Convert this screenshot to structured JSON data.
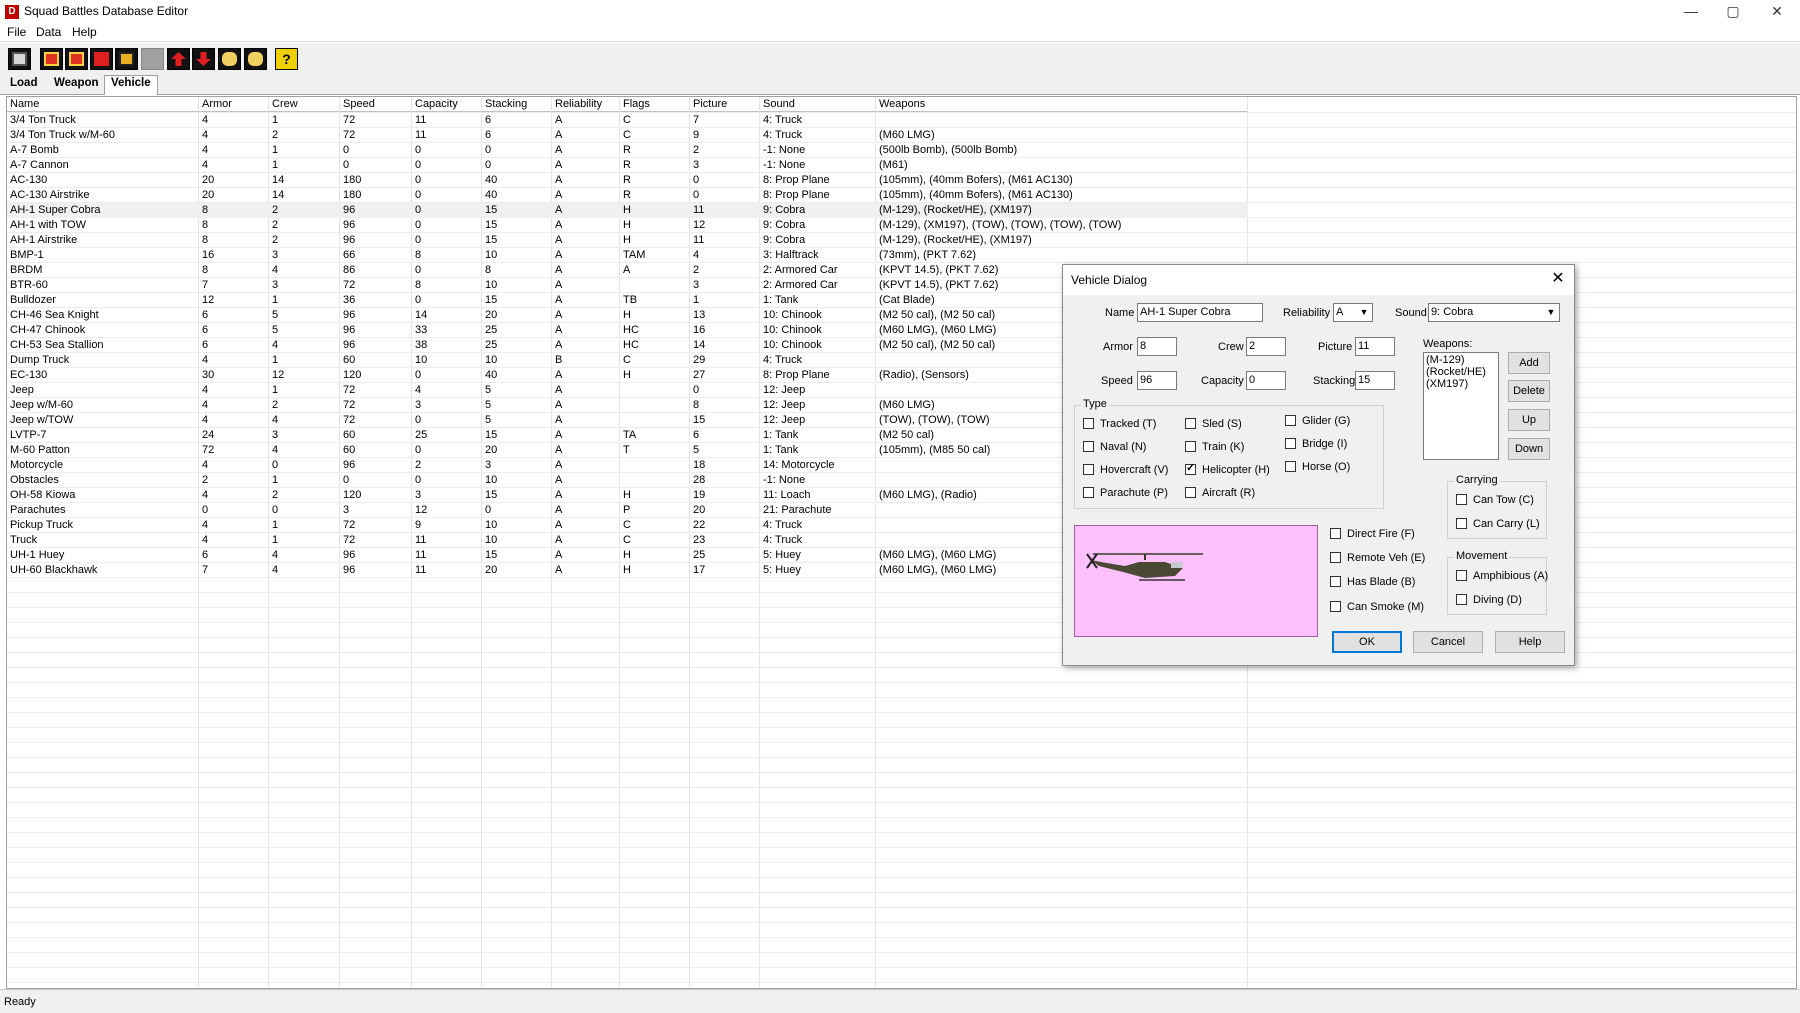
{
  "window": {
    "title": "Squad Battles Database Editor",
    "app_icon": "D",
    "buttons": {
      "minimize": "—",
      "maximize": "▢",
      "close": "✕"
    }
  },
  "menu": [
    "File",
    "Data",
    "Help"
  ],
  "toolbar": {
    "icons": [
      "save-icon",
      "new-record-icon",
      "new-record-2-icon",
      "delete-icon",
      "copy-icon",
      "disabled-icon",
      "move-up-icon",
      "move-down-icon",
      "binoculars-icon",
      "binoculars-2-icon",
      "help-icon"
    ],
    "help_glyph": "?"
  },
  "tabs": [
    "Load",
    "Weapon",
    "Vehicle"
  ],
  "grid": {
    "columns": [
      "Name",
      "Armor",
      "Crew",
      "Speed",
      "Capacity",
      "Stacking",
      "Reliability",
      "Flags",
      "Picture",
      "Sound",
      "Weapons"
    ],
    "rows": [
      [
        "3/4 Ton Truck",
        "4",
        "1",
        "72",
        "11",
        "6",
        "A",
        "C",
        "7",
        "4: Truck",
        ""
      ],
      [
        "3/4 Ton Truck w/M-60",
        "4",
        "2",
        "72",
        "11",
        "6",
        "A",
        "C",
        "9",
        "4: Truck",
        "(M60 LMG)"
      ],
      [
        "A-7 Bomb",
        "4",
        "1",
        "0",
        "0",
        "0",
        "A",
        "R",
        "2",
        "-1: None",
        "(500lb Bomb), (500lb Bomb)"
      ],
      [
        "A-7 Cannon",
        "4",
        "1",
        "0",
        "0",
        "0",
        "A",
        "R",
        "3",
        "-1: None",
        "(M61)"
      ],
      [
        "AC-130",
        "20",
        "14",
        "180",
        "0",
        "40",
        "A",
        "R",
        "0",
        "8: Prop Plane",
        "(105mm), (40mm Bofers), (M61 AC130)"
      ],
      [
        "AC-130 Airstrike",
        "20",
        "14",
        "180",
        "0",
        "40",
        "A",
        "R",
        "0",
        "8: Prop Plane",
        "(105mm), (40mm Bofers), (M61 AC130)"
      ],
      [
        "AH-1  Super Cobra",
        "8",
        "2",
        "96",
        "0",
        "15",
        "A",
        "H",
        "11",
        "9: Cobra",
        "(M-129), (Rocket/HE), (XM197)"
      ],
      [
        "AH-1 with TOW",
        "8",
        "2",
        "96",
        "0",
        "15",
        "A",
        "H",
        "12",
        "9: Cobra",
        "(M-129), (XM197), (TOW), (TOW), (TOW), (TOW)"
      ],
      [
        "AH-1 Airstrike",
        "8",
        "2",
        "96",
        "0",
        "15",
        "A",
        "H",
        "11",
        "9: Cobra",
        "(M-129), (Rocket/HE), (XM197)"
      ],
      [
        "BMP-1",
        "16",
        "3",
        "66",
        "8",
        "10",
        "A",
        "TAM",
        "4",
        "3: Halftrack",
        "(73mm), (PKT 7.62)"
      ],
      [
        "BRDM",
        "8",
        "4",
        "86",
        "0",
        "8",
        "A",
        "A",
        "2",
        "2: Armored Car",
        "(KPVT 14.5), (PKT 7.62)"
      ],
      [
        "BTR-60",
        "7",
        "3",
        "72",
        "8",
        "10",
        "A",
        "",
        "3",
        "2: Armored Car",
        "(KPVT 14.5), (PKT 7.62)"
      ],
      [
        "Bulldozer",
        "12",
        "1",
        "36",
        "0",
        "15",
        "A",
        "TB",
        "1",
        "1: Tank",
        "(Cat Blade)"
      ],
      [
        "CH-46 Sea Knight",
        "6",
        "5",
        "96",
        "14",
        "20",
        "A",
        "H",
        "13",
        "10: Chinook",
        "(M2 50 cal), (M2 50 cal)"
      ],
      [
        "CH-47 Chinook",
        "6",
        "5",
        "96",
        "33",
        "25",
        "A",
        "HC",
        "16",
        "10: Chinook",
        "(M60 LMG), (M60 LMG)"
      ],
      [
        "CH-53 Sea Stallion",
        "6",
        "4",
        "96",
        "38",
        "25",
        "A",
        "HC",
        "14",
        "10: Chinook",
        "(M2 50 cal), (M2 50 cal)"
      ],
      [
        "Dump Truck",
        "4",
        "1",
        "60",
        "10",
        "10",
        "B",
        "C",
        "29",
        "4: Truck",
        ""
      ],
      [
        "EC-130",
        "30",
        "12",
        "120",
        "0",
        "40",
        "A",
        "H",
        "27",
        "8: Prop Plane",
        "(Radio), (Sensors)"
      ],
      [
        "Jeep",
        "4",
        "1",
        "72",
        "4",
        "5",
        "A",
        "",
        "0",
        "12: Jeep",
        ""
      ],
      [
        "Jeep w/M-60",
        "4",
        "2",
        "72",
        "3",
        "5",
        "A",
        "",
        "8",
        "12: Jeep",
        "(M60 LMG)"
      ],
      [
        "Jeep w/TOW",
        "4",
        "4",
        "72",
        "0",
        "5",
        "A",
        "",
        "15",
        "12: Jeep",
        "(TOW), (TOW), (TOW)"
      ],
      [
        "LVTP-7",
        "24",
        "3",
        "60",
        "25",
        "15",
        "A",
        "TA",
        "6",
        "1: Tank",
        "(M2 50 cal)"
      ],
      [
        "M-60 Patton",
        "72",
        "4",
        "60",
        "0",
        "20",
        "A",
        "T",
        "5",
        "1: Tank",
        "(105mm), (M85 50 cal)"
      ],
      [
        "Motorcycle",
        "4",
        "0",
        "96",
        "2",
        "3",
        "A",
        "",
        "18",
        "14: Motorcycle",
        ""
      ],
      [
        "Obstacles",
        "2",
        "1",
        "0",
        "0",
        "10",
        "A",
        "",
        "28",
        "-1: None",
        ""
      ],
      [
        "OH-58 Kiowa",
        "4",
        "2",
        "120",
        "3",
        "15",
        "A",
        "H",
        "19",
        "11: Loach",
        "(M60 LMG), (Radio)"
      ],
      [
        "Parachutes",
        "0",
        "0",
        "3",
        "12",
        "0",
        "A",
        "P",
        "20",
        "21: Parachute",
        ""
      ],
      [
        "Pickup Truck",
        "4",
        "1",
        "72",
        "9",
        "10",
        "A",
        "C",
        "22",
        "4: Truck",
        ""
      ],
      [
        "Truck",
        "4",
        "1",
        "72",
        "11",
        "10",
        "A",
        "C",
        "23",
        "4: Truck",
        ""
      ],
      [
        "UH-1 Huey",
        "6",
        "4",
        "96",
        "11",
        "15",
        "A",
        "H",
        "25",
        "5: Huey",
        "(M60 LMG), (M60 LMG)"
      ],
      [
        "UH-60 Blackhawk",
        "7",
        "4",
        "96",
        "11",
        "20",
        "A",
        "H",
        "17",
        "5: Huey",
        "(M60 LMG), (M60 LMG)"
      ]
    ],
    "selected_row": 6
  },
  "status": "Ready",
  "dialog": {
    "title": "Vehicle Dialog",
    "close_glyph": "✕",
    "name_label": "Name",
    "name_value": "AH-1  Super Cobra",
    "reliability_label": "Reliability",
    "reliability_value": "A",
    "sound_label": "Sound",
    "sound_value": "9: Cobra",
    "armor_label": "Armor",
    "armor_value": "8",
    "crew_label": "Crew",
    "crew_value": "2",
    "picture_label": "Picture",
    "picture_value": "11",
    "speed_label": "Speed",
    "speed_value": "96",
    "capacity_label": "Capacity",
    "capacity_value": "0",
    "stacking_label": "Stacking",
    "stacking_value": "15",
    "weapons_label": "Weapons:",
    "weapons_list": [
      "(M-129)",
      "(Rocket/HE)",
      "(XM197)"
    ],
    "weapon_buttons": [
      "Add",
      "Delete",
      "Up",
      "Down"
    ],
    "type_label": "Type",
    "type_checks": [
      {
        "label": "Tracked (T)",
        "checked": false
      },
      {
        "label": "Naval (N)",
        "checked": false
      },
      {
        "label": "Hovercraft (V)",
        "checked": false
      },
      {
        "label": "Parachute (P)",
        "checked": false
      },
      {
        "label": "Sled (S)",
        "checked": false
      },
      {
        "label": "Train (K)",
        "checked": false
      },
      {
        "label": "Helicopter (H)",
        "checked": true
      },
      {
        "label": "Aircraft (R)",
        "checked": false
      },
      {
        "label": "Glider (G)",
        "checked": false
      },
      {
        "label": "Bridge (I)",
        "checked": false
      },
      {
        "label": "Horse (O)",
        "checked": false
      }
    ],
    "flag_checks": [
      {
        "label": "Direct Fire (F)",
        "checked": false
      },
      {
        "label": "Remote Veh (E)",
        "checked": false
      },
      {
        "label": "Has Blade (B)",
        "checked": false
      },
      {
        "label": "Can Smoke (M)",
        "checked": false
      }
    ],
    "carrying_label": "Carrying",
    "carrying_checks": [
      {
        "label": "Can Tow (C)",
        "checked": false
      },
      {
        "label": "Can Carry (L)",
        "checked": false
      }
    ],
    "movement_label": "Movement",
    "movement_checks": [
      {
        "label": "Amphibious (A)",
        "checked": false
      },
      {
        "label": "Diving (D)",
        "checked": false
      }
    ],
    "ok_label": "OK",
    "cancel_label": "Cancel",
    "help_label": "Help",
    "preview_bg": "#ffc0ff"
  }
}
